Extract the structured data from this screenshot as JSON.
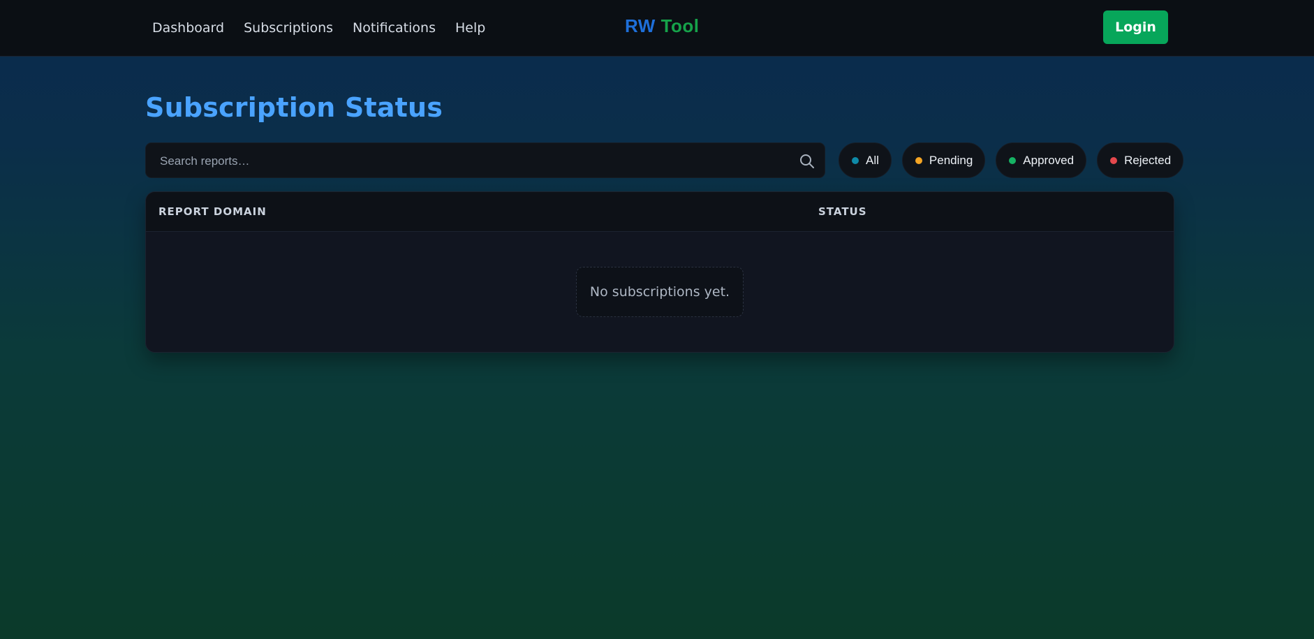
{
  "colors": {
    "brand_primary": "#1e6fd9",
    "brand_secondary": "#16a34a",
    "accent_green": "#07a65a",
    "title": "#4aa3ff",
    "filter_all": "#0e8aa8",
    "filter_pending": "#f5a524",
    "filter_approved": "#16b364",
    "filter_rejected": "#e5484d"
  },
  "nav": {
    "items": [
      {
        "label": "Dashboard"
      },
      {
        "label": "Subscriptions"
      },
      {
        "label": "Notifications"
      },
      {
        "label": "Help"
      }
    ]
  },
  "brand": {
    "part1": "RW",
    "part2": "Tool"
  },
  "header": {
    "login_label": "Login"
  },
  "main": {
    "title": "Subscription Status",
    "search": {
      "placeholder": "Search reports…",
      "value": "",
      "icon": "search-icon"
    },
    "filters": [
      {
        "label": "All",
        "color_key": "filter_all"
      },
      {
        "label": "Pending",
        "color_key": "filter_pending"
      },
      {
        "label": "Approved",
        "color_key": "filter_approved"
      },
      {
        "label": "Rejected",
        "color_key": "filter_rejected"
      }
    ],
    "table": {
      "columns": [
        "REPORT DOMAIN",
        "STATUS"
      ],
      "rows": [],
      "empty_message": "No subscriptions yet."
    }
  }
}
